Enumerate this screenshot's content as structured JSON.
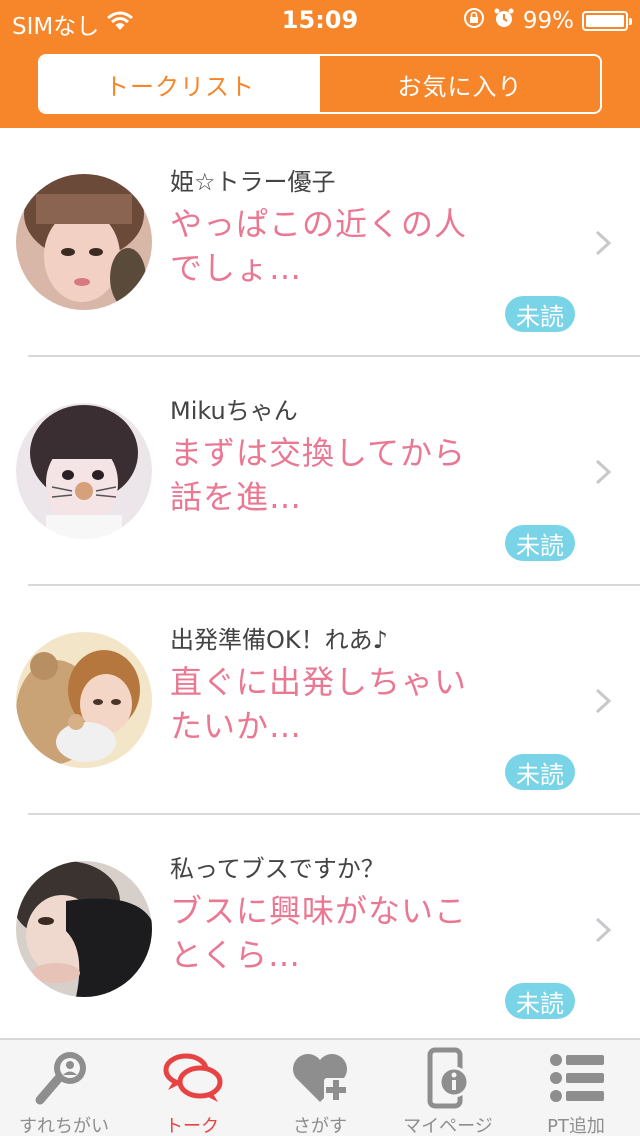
{
  "status_bar": {
    "carrier": "SIMなし",
    "time": "15:09",
    "battery_percent": "99%",
    "battery_level": 0.99,
    "icons": [
      "wifi-icon",
      "rotation-lock-icon",
      "alarm-icon",
      "battery-icon"
    ]
  },
  "segment": {
    "tabs": [
      {
        "label": "トークリスト",
        "active": true
      },
      {
        "label": "お気に入り",
        "active": false
      }
    ]
  },
  "talks": [
    {
      "name": "姫☆トラー優子",
      "preview": "やっぱこの近くの人でしょ…",
      "badge": "未読"
    },
    {
      "name": "Mikuちゃん",
      "preview": "まずは交換してから話を進…",
      "badge": "未読"
    },
    {
      "name": "出発準備OK！れあ♪",
      "preview": "直ぐに出発しちゃいたいか…",
      "badge": "未読"
    },
    {
      "name": "私ってブスですか？",
      "preview": "ブスに興味がないことくら…",
      "badge": "未読"
    }
  ],
  "tabbar": {
    "items": [
      {
        "label": "すれちがい",
        "icon": "magnifier-person-icon",
        "active": false
      },
      {
        "label": "トーク",
        "icon": "chat-bubbles-icon",
        "active": true
      },
      {
        "label": "さがす",
        "icon": "heart-plus-icon",
        "active": false
      },
      {
        "label": "マイページ",
        "icon": "phone-info-icon",
        "active": false
      },
      {
        "label": "PT追加",
        "icon": "list-icon",
        "active": false
      }
    ]
  },
  "colors": {
    "brand_orange": "#f7852a",
    "preview_pink": "#ea7893",
    "badge_cyan": "#79d4e8",
    "active_tab_red": "#e84343",
    "inactive_gray": "#8e8e8e"
  }
}
